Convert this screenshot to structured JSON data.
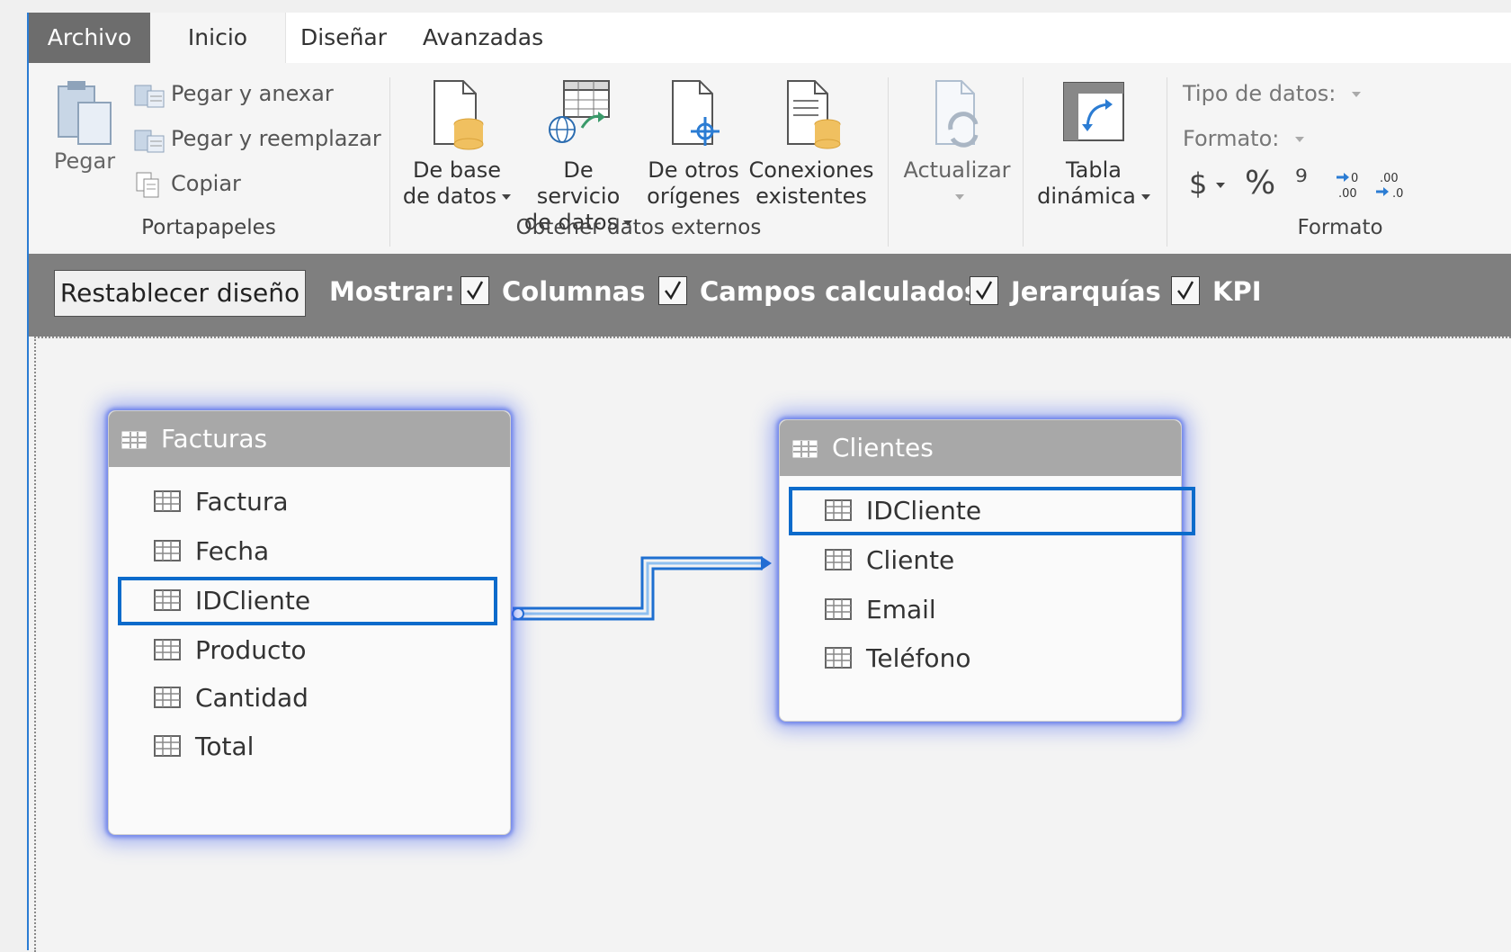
{
  "tabs": {
    "archivo": "Archivo",
    "inicio": "Inicio",
    "disenar": "Diseñar",
    "avanzadas": "Avanzadas"
  },
  "ribbon": {
    "portapapeles": {
      "label": "Portapapeles",
      "pegar": "Pegar",
      "pegar_anexar": "Pegar y anexar",
      "pegar_reemplazar": "Pegar y reemplazar",
      "copiar": "Copiar"
    },
    "externos": {
      "label": "Obtener datos externos",
      "db_l1": "De base",
      "db_l2": "de datos",
      "srv_l1": "De servicio",
      "srv_l2": "de datos",
      "otros_l1": "De otros",
      "otros_l2": "orígenes",
      "conex_l1": "Conexiones",
      "conex_l2": "existentes"
    },
    "actualizar": "Actualizar",
    "tabla_l1": "Tabla",
    "tabla_l2": "dinámica",
    "formato": {
      "label": "Formato",
      "tipo_datos": "Tipo de datos:",
      "formato": "Formato:",
      "dollar": "$",
      "percent": "%",
      "comma": "⁹"
    }
  },
  "toolbar": {
    "reset": "Restablecer diseño",
    "mostrar": "Mostrar:",
    "columnas": "Columnas",
    "campos": "Campos calculados",
    "jerarquias": "Jerarquías",
    "kpi": "KPI"
  },
  "tables": {
    "facturas": {
      "title": "Facturas",
      "columns": [
        "Factura",
        "Fecha",
        "IDCliente",
        "Producto",
        "Cantidad",
        "Total"
      ]
    },
    "clientes": {
      "title": "Clientes",
      "columns": [
        "IDCliente",
        "Cliente",
        "Email",
        "Teléfono"
      ]
    }
  },
  "colors": {
    "accent": "#0b6bcb",
    "tab_file_bg": "#6d6d6d",
    "toolbar_bg": "#7f7f7f",
    "table_header": "#a8a8a8"
  }
}
